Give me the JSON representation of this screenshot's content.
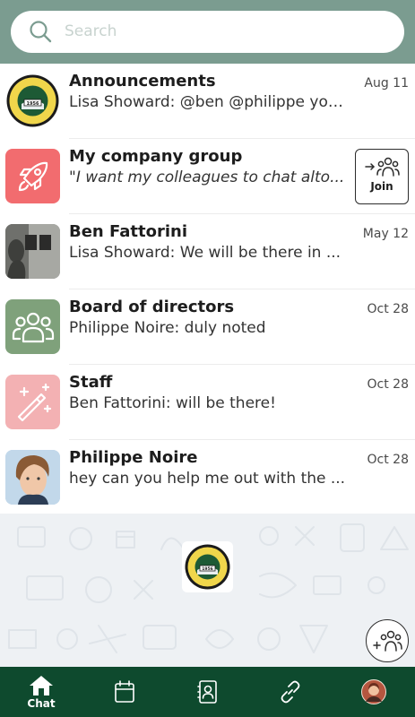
{
  "search": {
    "placeholder": "Search"
  },
  "chats": [
    {
      "title": "Announcements",
      "preview": "Lisa Showard: @ben @philippe you ...",
      "date": "Aug 11"
    },
    {
      "title": "My company group",
      "preview": "\"I want my colleagues to chat alto...",
      "join_label": "Join"
    },
    {
      "title": "Ben Fattorini",
      "preview": "Lisa Showard: We will be there in ...",
      "date": "May 12"
    },
    {
      "title": "Board of directors",
      "preview": "Philippe Noire: duly noted",
      "date": "Oct 28"
    },
    {
      "title": "Staff",
      "preview": "Ben Fattorini: will be there!",
      "date": "Oct 28"
    },
    {
      "title": "Philippe Noire",
      "preview": "hey can you help me out with the ...",
      "date": "Oct 28"
    }
  ],
  "logo": {
    "top": "MIDDLE ISLAND",
    "bottom": "TEACHERS' ASSOCIATION",
    "est": "est. 1956"
  },
  "nav": {
    "chat_label": "Chat"
  },
  "colors": {
    "header": "#7b9c90",
    "nav": "#0e4a2e",
    "rocket_tile": "#f26c6f",
    "board_tile": "#7fa17b",
    "staff_tile": "#f3b1b3"
  }
}
